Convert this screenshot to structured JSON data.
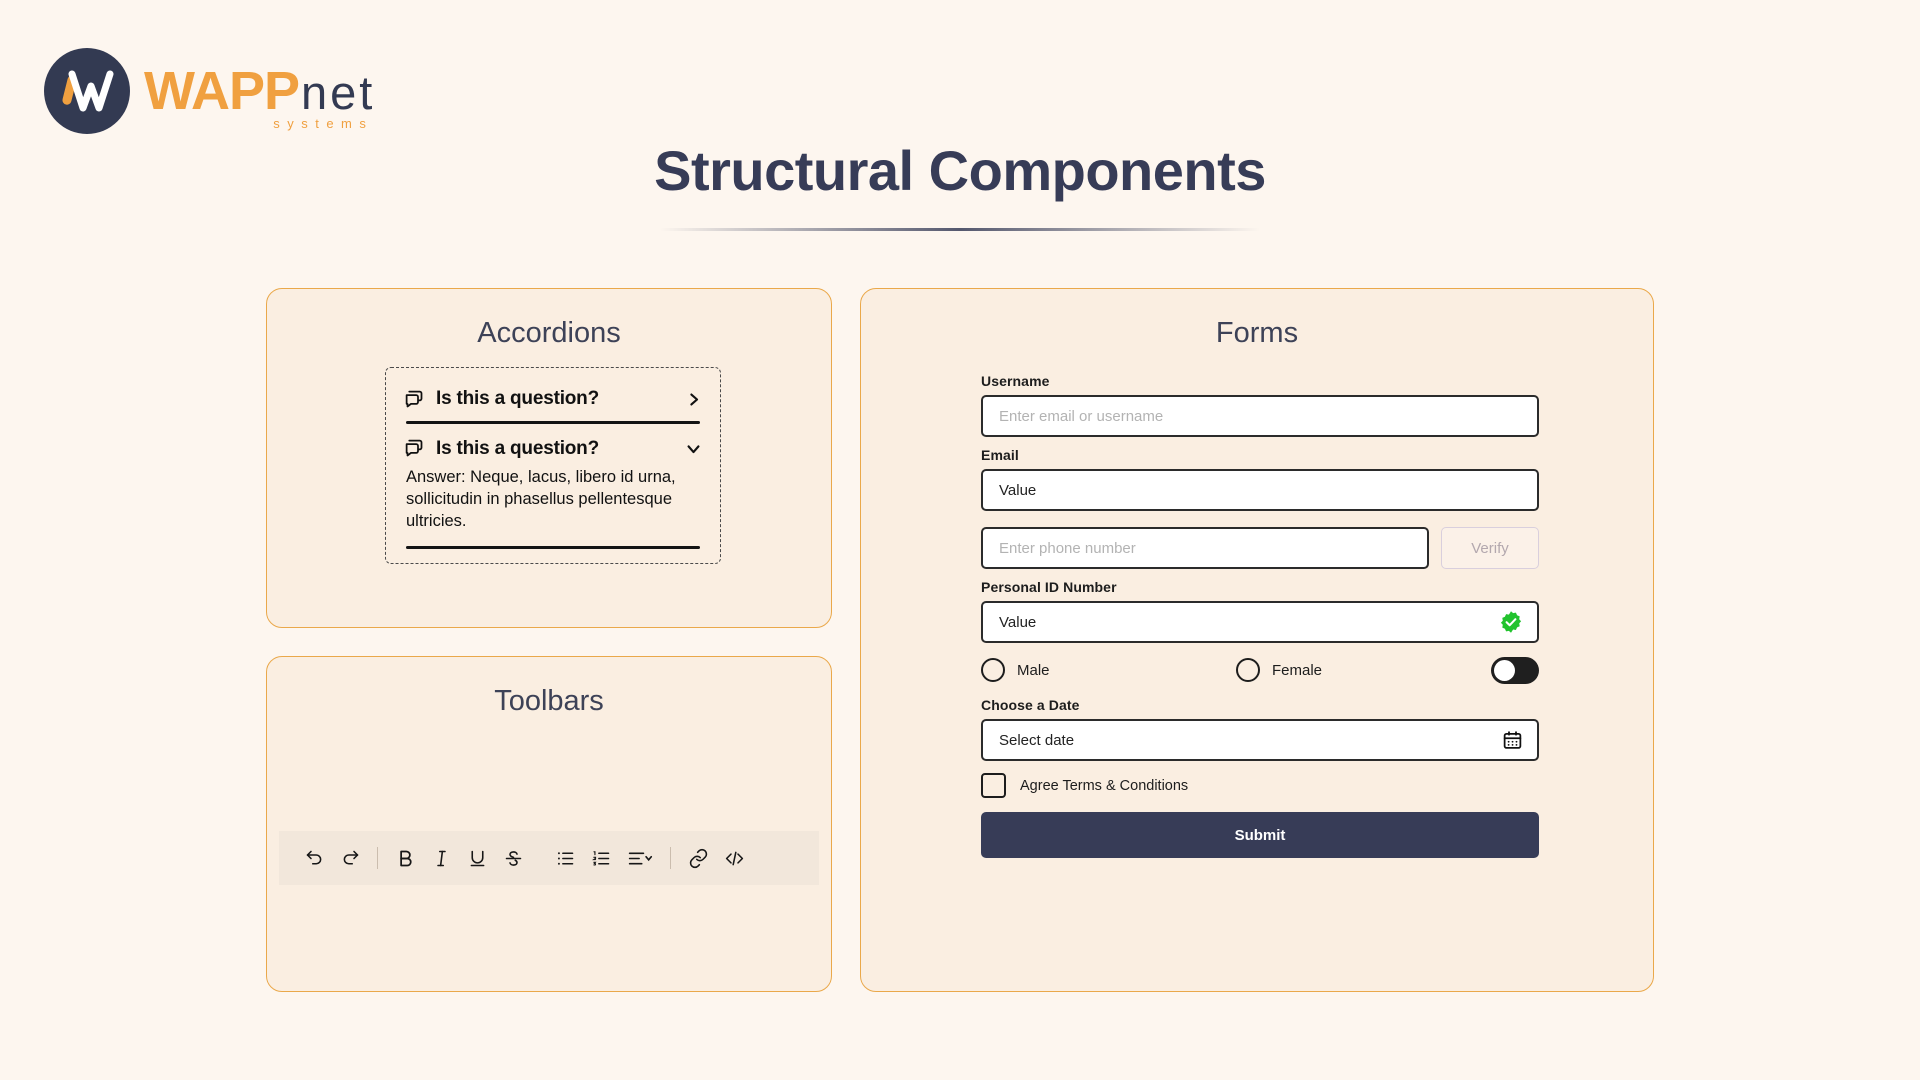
{
  "logo": {
    "wapp": "WAPP",
    "net": "net",
    "systems": "systems"
  },
  "page": {
    "title": "Structural Components"
  },
  "panels": {
    "accordions": {
      "heading": "Accordions"
    },
    "toolbars": {
      "heading": "Toolbars"
    },
    "forms": {
      "heading": "Forms"
    }
  },
  "accordions": {
    "items": [
      {
        "title": "Is this a question?",
        "icon": "chat-bubble-icon",
        "chevron": "chevron-right-icon",
        "expanded": false,
        "answer": ""
      },
      {
        "title": "Is this a question?",
        "icon": "chat-bubble-icon",
        "chevron": "chevron-down-icon",
        "expanded": true,
        "answer": "Answer: Neque, lacus, libero id urna, sollicitudin in phasellus pellentesque ultricies."
      }
    ]
  },
  "toolbar": {
    "buttons": [
      {
        "name": "undo-icon",
        "label": "Undo"
      },
      {
        "name": "redo-icon",
        "label": "Redo"
      },
      {
        "name": "bold-icon",
        "label": "B"
      },
      {
        "name": "italic-icon",
        "label": "I"
      },
      {
        "name": "underline-icon",
        "label": "U"
      },
      {
        "name": "strikethrough-icon",
        "label": "S"
      },
      {
        "name": "bullet-list-icon",
        "label": "Bulleted list"
      },
      {
        "name": "numbered-list-icon",
        "label": "Numbered list"
      },
      {
        "name": "align-dropdown-icon",
        "label": "Align"
      },
      {
        "name": "link-icon",
        "label": "Link"
      },
      {
        "name": "code-icon",
        "label": "Code"
      }
    ]
  },
  "form": {
    "username": {
      "label": "Username",
      "placeholder": "Enter email or username",
      "value": ""
    },
    "email": {
      "label": "Email",
      "placeholder": "",
      "value": "Value"
    },
    "phone": {
      "placeholder": "Enter phone number",
      "value": ""
    },
    "verify_button": "Verify",
    "personal_id": {
      "label": "Personal ID Number",
      "value": "Value",
      "badge": "verified-check-icon"
    },
    "gender": {
      "male": "Male",
      "female": "Female"
    },
    "date": {
      "label": "Choose a Date",
      "placeholder": "Select date",
      "value": ""
    },
    "terms": "Agree Terms & Conditions",
    "submit": "Submit"
  },
  "colors": {
    "background": "#fdf6ef",
    "panel_bg": "#faeee1",
    "panel_border": "#eaa84a",
    "accent_orange": "#f0a040",
    "navy": "#373c57",
    "verified_green": "#22c32e"
  }
}
